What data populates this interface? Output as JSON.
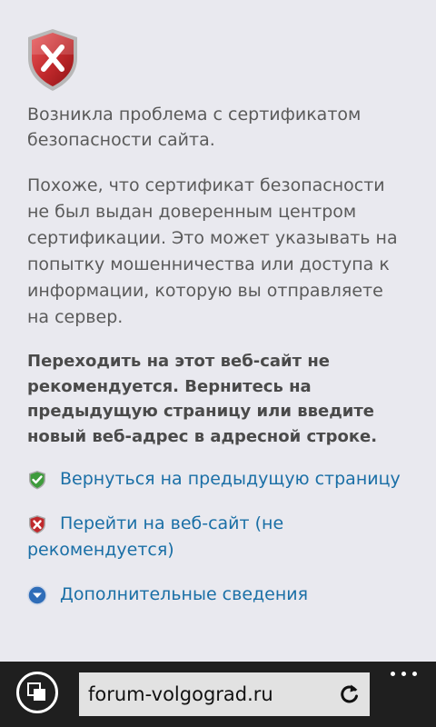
{
  "error_page": {
    "title": "Возникла проблема с сертификатом безопасности сайта.",
    "description": "Похоже, что сертификат безопасности не был выдан доверенным центром сертификации. Это может указывать на попытку мошенничества или доступа к информации, которую вы отправляете на сервер.",
    "warning": "Переходить на этот веб-сайт не рекомендуется. Вернитесь на предыдущую страницу или введите новый веб-адрес в адресной строке.",
    "links": {
      "back": "Вернуться на предыдущую страницу",
      "continue": "Перейти на веб-сайт (не рекомендуется)",
      "more_info": "Дополнительные сведения"
    }
  },
  "appbar": {
    "url": "forum-volgograd.ru"
  },
  "icons": {
    "main": "shield-error-icon",
    "back": "shield-check-icon",
    "continue": "shield-error-icon",
    "more_info": "expand-down-icon",
    "tabs": "tabs-icon",
    "refresh": "refresh-icon",
    "more": "more-dots-icon"
  },
  "colors": {
    "background": "#e9e9ef",
    "text": "#5a5a5a",
    "link": "#1a6fa6",
    "shield_red": "#c0282b",
    "shield_green": "#3e9b3c",
    "appbar": "#1f1f1f",
    "address_bg": "#e2e2e2"
  }
}
